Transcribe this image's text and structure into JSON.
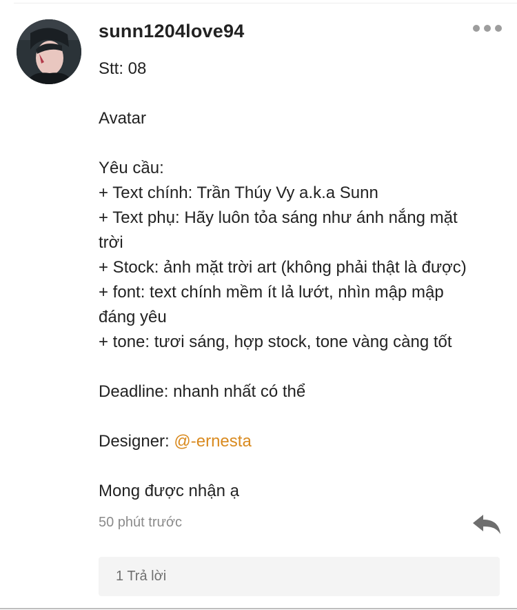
{
  "post": {
    "username": "sunn1204love94",
    "content_lines": [
      "Stt: 08",
      "",
      "Avatar",
      "",
      "Yêu cầu:",
      "+ Text chính: Trần Thúy Vy a.k.a Sunn",
      "+ Text phụ: Hãy luôn tỏa sáng như ánh nắng mặt",
      "trời",
      "+ Stock: ảnh mặt trời art (không phải thật là được)",
      "+ font: text chính mềm ít lả lướt, nhìn mập mập",
      "đáng yêu",
      "+ tone: tươi sáng, hợp stock, tone vàng càng tốt",
      "",
      "Deadline: nhanh nhất có thể",
      ""
    ],
    "designer_label": "Designer: ",
    "designer_mention": "@-ernesta",
    "closing": "Mong được nhận ạ",
    "timestamp": "50 phút trước",
    "reply_count_label": "1 Trả lời"
  },
  "icons": {
    "more": "more-options-icon",
    "reply": "reply-arrow-icon"
  },
  "colors": {
    "mention": "#d98a1f",
    "muted_text": "#8a8a8a",
    "reply_box_bg": "#f4f4f4",
    "icon_gray": "#9d9d9d"
  }
}
